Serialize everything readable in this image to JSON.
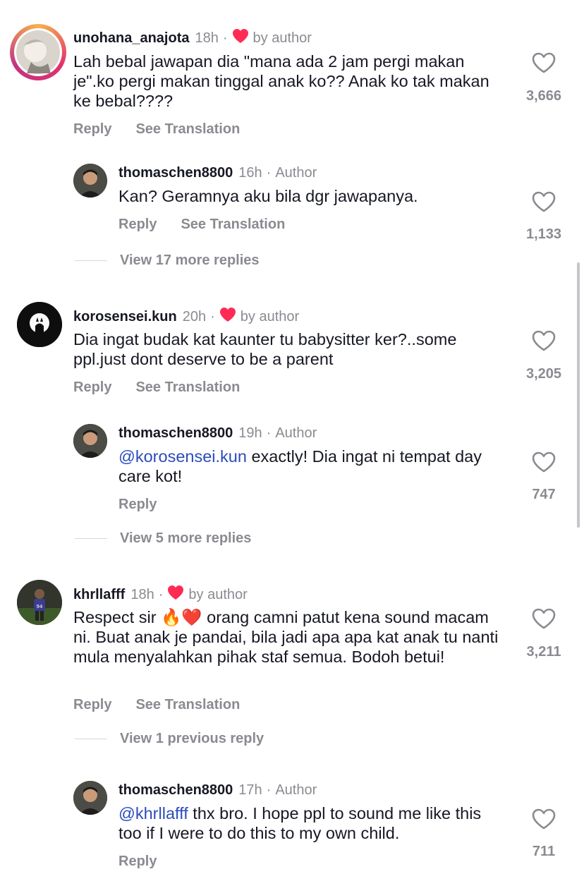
{
  "colors": {
    "username": "#161823",
    "meta": "#8a8b91",
    "mention": "#2b4bbd",
    "heart": "#fe2c55"
  },
  "comments": [
    {
      "username": "unohana_anajota",
      "time": "18h",
      "dot": "·",
      "badge": "by author",
      "text": "Lah bebal jawapan dia \"mana ada 2 jam pergi makan je\".ko pergi makan tinggal anak ko?? Anak ko tak makan ke bebal????",
      "reply_label": "Reply",
      "translate_label": "See Translation",
      "likes": "3,666",
      "reply": {
        "username": "thomaschen8800",
        "time": "16h",
        "dot": "·",
        "role": "Author",
        "text": "Kan? Geramnya aku bila dgr jawapanya.",
        "reply_label": "Reply",
        "translate_label": "See Translation",
        "likes": "1,133"
      },
      "view_more": "View 17 more replies"
    },
    {
      "username": "korosensei.kun",
      "time": "20h",
      "dot": "·",
      "badge": "by author",
      "text": "Dia ingat budak kat kaunter tu babysitter ker?..some ppl.just dont deserve to be a parent",
      "reply_label": "Reply",
      "translate_label": "See Translation",
      "likes": "3,205",
      "reply": {
        "username": "thomaschen8800",
        "time": "19h",
        "dot": "·",
        "role": "Author",
        "mention": "@korosensei.kun",
        "text": " exactly! Dia ingat ni tempat day care kot!",
        "reply_label": "Reply",
        "likes": "747"
      },
      "view_more": "View 5 more replies"
    },
    {
      "username": "khrllafff",
      "time": "18h",
      "dot": "·",
      "badge": "by author",
      "text_before": "Respect sir ",
      "emoji": "🔥❤️",
      "text_after": " orang camni patut kena sound macam ni. Buat anak je pandai, bila jadi apa apa kat anak tu nanti mula menyalahkan pihak staf semua. Bodoh betui!",
      "reply_label": "Reply",
      "translate_label": "See Translation",
      "likes": "3,211",
      "view_more": "View 1 previous reply",
      "reply": {
        "username": "thomaschen8800",
        "time": "17h",
        "dot": "·",
        "role": "Author",
        "mention": "@khrllafff",
        "text": " thx bro. I hope ppl to sound me like this too if I were to do this to my own child.",
        "reply_label": "Reply",
        "likes": "711"
      }
    }
  ]
}
